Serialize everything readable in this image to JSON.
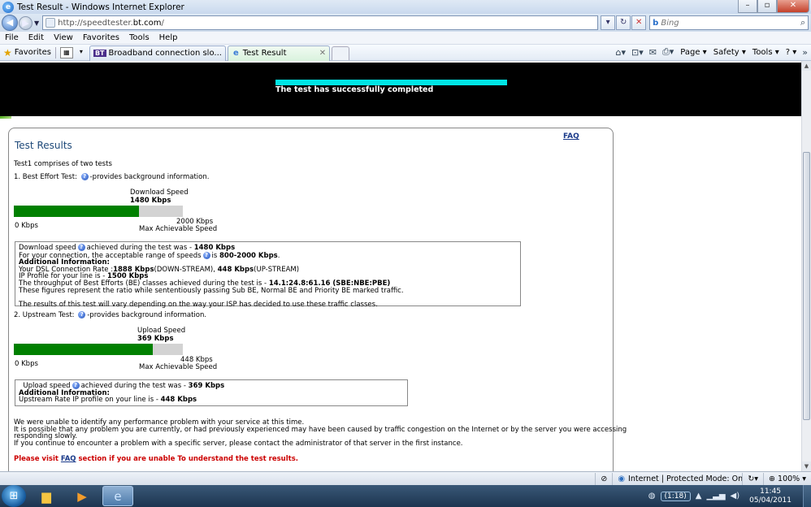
{
  "window": {
    "title": "Test Result - Windows Internet Explorer"
  },
  "address": {
    "url_prefix": "http://speedtester.",
    "url_domain": "bt.com",
    "url_suffix": "/"
  },
  "search": {
    "placeholder": "Bing",
    "engine_label": "b"
  },
  "menu": [
    "File",
    "Edit",
    "View",
    "Favorites",
    "Tools",
    "Help"
  ],
  "favbar": {
    "favorites": "Favorites"
  },
  "tabs": [
    {
      "icon": "BT",
      "label": "Broadband connection slo..."
    },
    {
      "icon": "e",
      "label": "Test Result"
    }
  ],
  "commands": {
    "page": "Page ▾",
    "safety": "Safety ▾",
    "tools": "Tools ▾",
    "help": "? ▾"
  },
  "banner": {
    "message": "The test has successfully completed"
  },
  "results": {
    "faq": "FAQ",
    "title": "Test Results",
    "intro": "Test1 comprises of two tests",
    "test1": {
      "heading": "1. Best Effort Test:",
      "help_text": "-provides background information.",
      "gauge_title": "Download Speed",
      "gauge_value": "1480 Kbps",
      "min_label": "0 Kbps",
      "max_label": "2000 Kbps",
      "max_caption": "Max Achievable Speed",
      "fill_fraction": 0.74,
      "box": {
        "l1a": "Download speed",
        "l1b": "achieved during the test was - ",
        "l1c": "1480 Kbps",
        "l2a": "For your connection, the acceptable range of speeds",
        "l2b": "is ",
        "l2c": "800-2000 Kbps",
        "l2d": ".",
        "l3": "Additional Information:",
        "l4a": "Your DSL Connection Rate :",
        "l4b": "1888 Kbps",
        "l4c": "(DOWN-STREAM), ",
        "l4d": "448 Kbps",
        "l4e": "(UP-STREAM)",
        "l5a": "IP Profile for your line is - ",
        "l5b": "1500 Kbps",
        "l6a": "The throughput of Best Efforts (BE) classes achieved during the test is - ",
        "l6b": "14.1:24.8:61.16 (SBE:NBE:PBE)",
        "l7": "These figures represent the ratio while sententiously passing Sub BE, Normal BE and Priority BE marked traffic.",
        "l8": "The results of this test will vary depending on the way your ISP has decided to use these traffic classes."
      }
    },
    "test2": {
      "heading": "2. Upstream Test:",
      "help_text": "-provides background information.",
      "gauge_title": "Upload Speed",
      "gauge_value": "369 Kbps",
      "min_label": "0 Kbps",
      "max_label": "448 Kbps",
      "max_caption": "Max Achievable Speed",
      "fill_fraction": 0.82,
      "box": {
        "l1a": "Upload speed",
        "l1b": "achieved during the test was - ",
        "l1c": "369 Kbps",
        "l2": "Additional Information:",
        "l3a": "Upstream Rate IP profile on your line is - ",
        "l3b": "448 Kbps"
      }
    },
    "footer": {
      "p1": "We were unable to identify any performance problem with your service at this time.",
      "p2": "It is possible that any problem you are currently, or had previously experienced may have been caused by traffic congestion on the Internet or by the server you were accessing",
      "p3": "responding slowly.",
      "p4": "If you continue to encounter a problem with a specific server, please contact the administrator of that server in the first instance.",
      "visit_a": "Please visit ",
      "visit_link": "FAQ",
      "visit_b": " section if you are unable To understand the test results."
    }
  },
  "status": {
    "zone": "Internet | Protected Mode: On",
    "zoom": "100%"
  },
  "taskbar": {
    "tray_pill": "(1:18)",
    "time": "11:45",
    "date": "05/04/2011"
  }
}
